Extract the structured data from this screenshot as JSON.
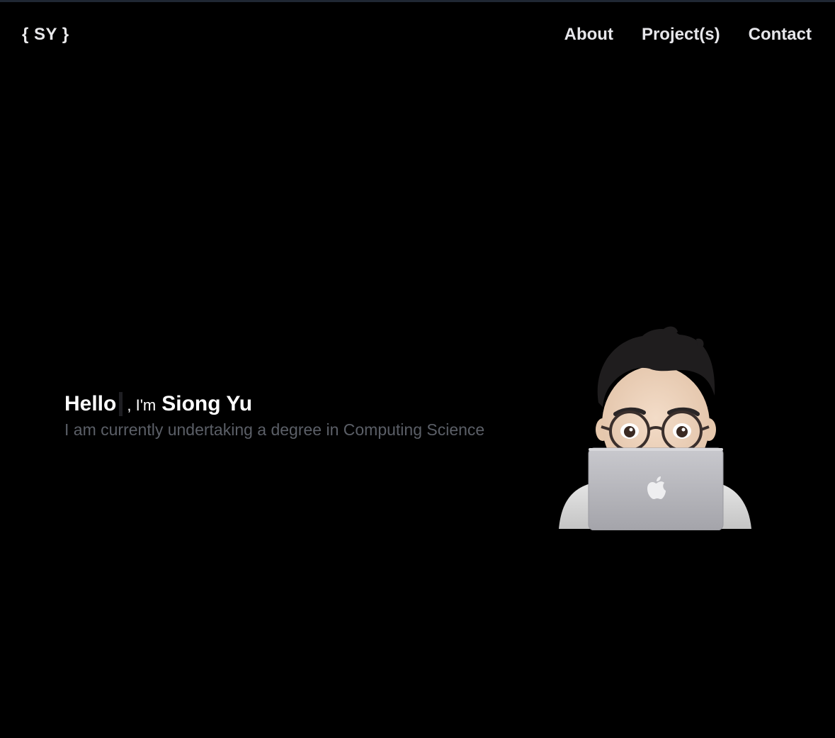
{
  "nav": {
    "logo": "{ SY }",
    "links": [
      {
        "label": "About"
      },
      {
        "label": "Project(s)"
      },
      {
        "label": "Contact"
      }
    ]
  },
  "hero": {
    "hello": "Hello",
    "im": ", I'm",
    "name": "Siong Yu",
    "subtitle": "I am currently undertaking a degree in Computing Science"
  },
  "avatar": {
    "icon": "memoji-with-laptop",
    "laptop_logo_icon": "apple-logo"
  },
  "colors": {
    "background": "#000000",
    "nav_text": "#e6e6ea",
    "subtitle": "#5b5f67",
    "top_border": "#1f2733"
  }
}
